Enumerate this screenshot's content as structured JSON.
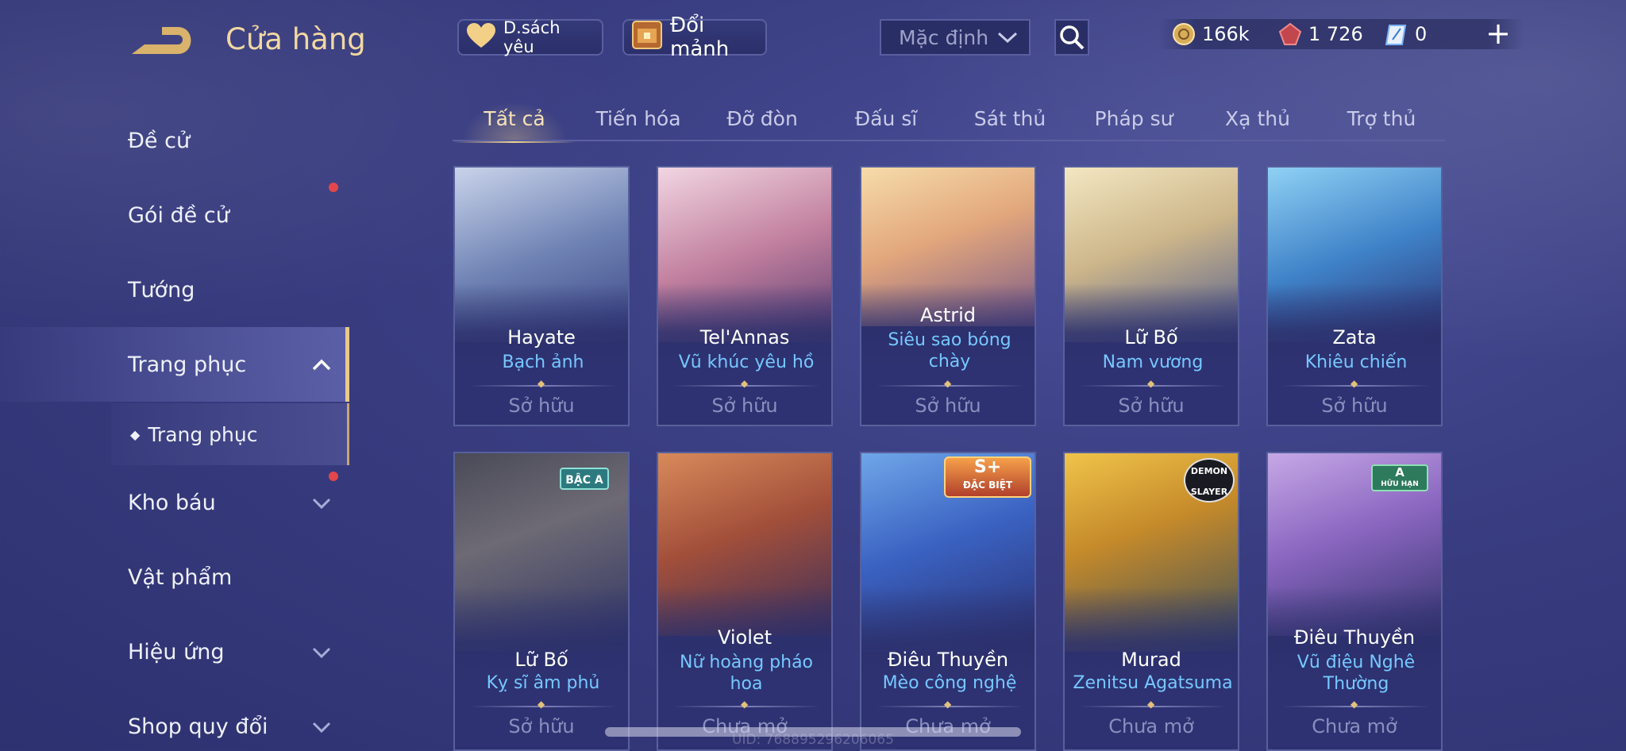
{
  "header": {
    "title": "Cửa hàng",
    "favorites_label": "D.sách yêu",
    "exchange_label": "Đổi mảnh",
    "sort_value": "Mặc định"
  },
  "currencies": {
    "coins": "166k",
    "vouchers": "1 726",
    "tickets": "0"
  },
  "sidebar": {
    "items": [
      {
        "label": "Đề cử"
      },
      {
        "label": "Gói đề cử"
      },
      {
        "label": "Tướng"
      },
      {
        "label": "Trang phục"
      },
      {
        "label": "Kho báu"
      },
      {
        "label": "Vật phẩm"
      },
      {
        "label": "Hiệu ứng"
      },
      {
        "label": "Shop quy đổi"
      }
    ],
    "sub_item": "Trang phục"
  },
  "tabs": [
    "Tất cả",
    "Tiến hóa",
    "Đỡ đòn",
    "Đấu sĩ",
    "Sát thủ",
    "Pháp sư",
    "Xạ thủ",
    "Trợ thủ"
  ],
  "cards": [
    {
      "hero": "Hayate",
      "skin": "Bạch ảnh",
      "status": "Sở hữu",
      "art": "#8aa0c8"
    },
    {
      "hero": "Tel'Annas",
      "skin": "Vũ khúc yêu hồ",
      "status": "Sở hữu",
      "art": "#c98aa8"
    },
    {
      "hero": "Astrid",
      "skin": "Siêu sao bóng chày",
      "status": "Sở hữu",
      "art": "#e8b880"
    },
    {
      "hero": "Lữ Bố",
      "skin": "Nam vương",
      "status": "Sở hữu",
      "art": "#d8c8a0"
    },
    {
      "hero": "Zata",
      "skin": "Khiêu chiến",
      "status": "Sở hữu",
      "art": "#5aa0d8"
    },
    {
      "hero": "Lữ Bố",
      "skin": "Kỵ sĩ âm phủ",
      "status": "Sở hữu",
      "art": "#6a6870",
      "badge": "BẬC A"
    },
    {
      "hero": "Violet",
      "skin": "Nữ hoàng pháo hoa",
      "status": "Chưa mở",
      "art": "#b86a4a"
    },
    {
      "hero": "Điêu Thuyền",
      "skin": "Mèo công nghệ",
      "status": "Chưa mở",
      "art": "#4a7ad8",
      "badge": "S+",
      "badge_sub": "ĐẶC BIỆT"
    },
    {
      "hero": "Murad",
      "skin": "Zenitsu Agatsuma",
      "status": "Chưa mở",
      "art": "#d8a83a",
      "badge": "DEMON SLAYER"
    },
    {
      "hero": "Điêu Thuyền",
      "skin": "Vũ điệu Nghê Thường",
      "status": "Chưa mở",
      "art": "#9a7ac8",
      "badge": "A",
      "badge_sub": "HỮU HẠN"
    }
  ],
  "uid_text": "UID: 768895296206065"
}
